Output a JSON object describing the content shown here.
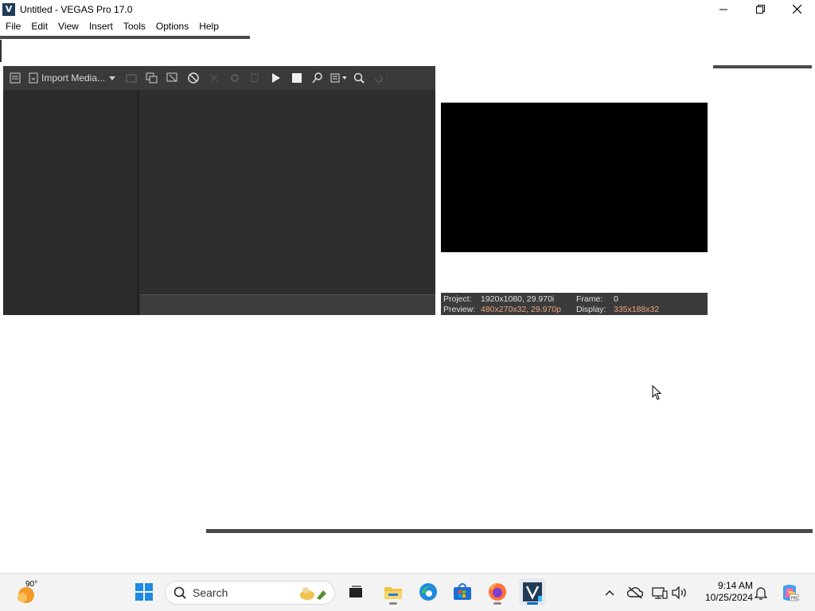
{
  "window": {
    "title": "Untitled - VEGAS Pro 17.0",
    "logo_letter": "V"
  },
  "menu": [
    "File",
    "Edit",
    "View",
    "Insert",
    "Tools",
    "Options",
    "Help"
  ],
  "media_toolbar": {
    "import_label": "Import Media..."
  },
  "preview_info": {
    "project_label": "Project:",
    "project_value": "1920x1080, 29.970i",
    "frame_label": "Frame:",
    "frame_value": "0",
    "preview_label": "Preview:",
    "preview_value": "480x270x32, 29.970p",
    "display_label": "Display:",
    "display_value": "335x188x32"
  },
  "taskbar": {
    "weather_temp": "90°",
    "search_placeholder": "Search",
    "time": "9:14 AM",
    "date": "10/25/2024"
  },
  "colors": {
    "panel_bg": "#2b2b2b",
    "toolbar_bg": "#3a3a3a",
    "accent_value": "#e8a480",
    "taskbar_bg": "#f3f3f3",
    "vegas_blue": "#1f3b57"
  }
}
